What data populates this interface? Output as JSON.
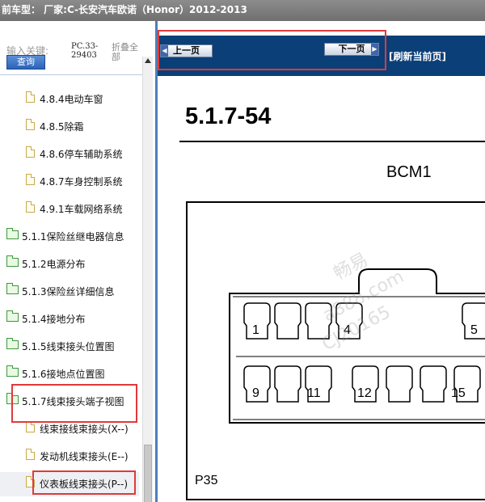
{
  "window": {
    "title": "前车型： 厂家:C-长安汽车欧诺（Honor）2012-2013"
  },
  "sidebar": {
    "search_label": "输入关键:",
    "query_button": "查询",
    "code_line1": "PC.33-",
    "code_line2": "29403",
    "collapse_line1": "折叠全",
    "collapse_line2": "部",
    "items": [
      {
        "label": "4.8.4电动车窗",
        "type": "file"
      },
      {
        "label": "4.8.5除霜",
        "type": "file"
      },
      {
        "label": "4.8.6停车辅助系统",
        "type": "file"
      },
      {
        "label": "4.8.7车身控制系统",
        "type": "file"
      },
      {
        "label": "4.9.1车载网络系统",
        "type": "file"
      },
      {
        "label": "5.1.1保险丝继电器信息",
        "type": "folder"
      },
      {
        "label": "5.1.2电源分布",
        "type": "folder"
      },
      {
        "label": "5.1.3保险丝详细信息",
        "type": "folder"
      },
      {
        "label": "5.1.4接地分布",
        "type": "folder"
      },
      {
        "label": "5.1.5线束接头位置图",
        "type": "folder"
      },
      {
        "label": "5.1.6接地点位置图",
        "type": "folder"
      },
      {
        "label": "5.1.7线束接头端子视图",
        "type": "folder"
      },
      {
        "label": "线束接线束接头(X--)",
        "type": "file"
      },
      {
        "label": "发动机线束接头(E--)",
        "type": "file"
      },
      {
        "label": "仪表板线束接头(P--)",
        "type": "file"
      }
    ]
  },
  "toolbar": {
    "prev_label": "上一页",
    "next_label": "下一页",
    "refresh_label": "[刷新当前页]"
  },
  "content": {
    "page_code": "5.1.7-54",
    "connector_title": "BCM1",
    "connector_id": "P35",
    "pin_labels": [
      "1",
      "4",
      "5",
      "9",
      "11",
      "12",
      "15"
    ],
    "watermark_lines": [
      "畅易",
      "a888.com",
      "CJ20165"
    ]
  },
  "colors": {
    "title_bar": "#7d7d7d",
    "top_bar": "#0b3f78",
    "highlight": "#e03a3a",
    "folder_green": "#3c9a3c",
    "file_gold": "#c9a94a"
  }
}
